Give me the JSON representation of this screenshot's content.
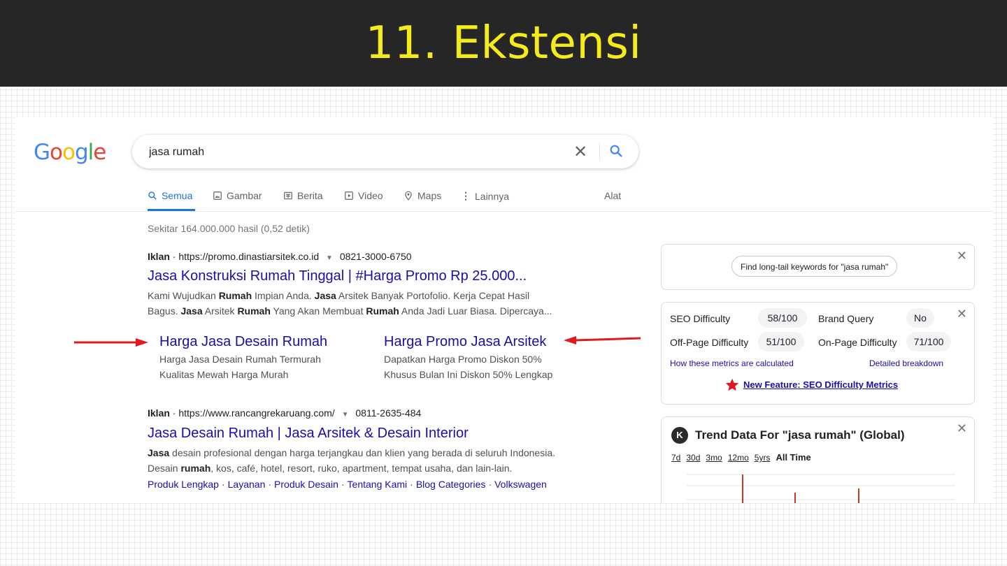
{
  "slide": {
    "title": "11. Ekstensi"
  },
  "google": {
    "logo": [
      {
        "ch": "G",
        "color": "#4285F4"
      },
      {
        "ch": "o",
        "color": "#EA4335"
      },
      {
        "ch": "o",
        "color": "#FBBC05"
      },
      {
        "ch": "g",
        "color": "#4285F4"
      },
      {
        "ch": "l",
        "color": "#34A853"
      },
      {
        "ch": "e",
        "color": "#EA4335"
      }
    ],
    "search": {
      "query": "jasa rumah",
      "clear_icon": "close-icon",
      "search_icon": "magnifier-icon"
    },
    "tabs": {
      "semua": {
        "label": "Semua",
        "icon": "search-icon"
      },
      "gambar": {
        "label": "Gambar",
        "icon": "image-icon"
      },
      "berita": {
        "label": "Berita",
        "icon": "news-icon"
      },
      "video": {
        "label": "Video",
        "icon": "play-icon"
      },
      "maps": {
        "label": "Maps",
        "icon": "pin-icon"
      },
      "lainnya": {
        "label": "Lainnya",
        "icon": "more-vert-icon"
      },
      "alat": {
        "label": "Alat"
      }
    },
    "stats": "Sekitar 164.000.000 hasil (0,52 detik)",
    "ad1": {
      "badge": "Iklan",
      "url": "https://promo.dinastiarsitek.co.id",
      "phone": "0821-3000-6750",
      "title": "Jasa Konstruksi Rumah Tinggal | #Harga Promo Rp 25.000...",
      "desc": [
        [
          {
            "t": "Kami Wujudkan "
          },
          {
            "t": "Rumah",
            "b": true
          },
          {
            "t": " Impian Anda. "
          },
          {
            "t": "Jasa",
            "b": true
          },
          {
            "t": " Arsitek Banyak Portofolio. Kerja Cepat Hasil"
          }
        ],
        [
          {
            "t": "Bagus. "
          },
          {
            "t": "Jasa",
            "b": true
          },
          {
            "t": " Arsitek "
          },
          {
            "t": "Rumah",
            "b": true
          },
          {
            "t": " Yang Akan Membuat "
          },
          {
            "t": "Rumah",
            "b": true
          },
          {
            "t": " Anda Jadi Luar Biasa. Dipercaya..."
          }
        ]
      ],
      "sitelinks": [
        {
          "title": "Harga Jasa Desain Rumah",
          "line1": "Harga Jasa Desain Rumah Termurah",
          "line2": "Kualitas Mewah Harga Murah"
        },
        {
          "title": "Harga Promo Jasa Arsitek",
          "line1": "Dapatkan Harga Promo Diskon 50%",
          "line2": "Khusus Bulan Ini Diskon 50% Lengkap"
        }
      ]
    },
    "ad2": {
      "badge": "Iklan",
      "url": "https://www.rancangrekaruang.com/",
      "phone": "0811-2635-484",
      "title": "Jasa Desain Rumah | Jasa Arsitek & Desain Interior",
      "desc": [
        [
          {
            "t": "Jasa",
            "b": true
          },
          {
            "t": " desain profesional dengan harga terjangkau dan klien yang berada di seluruh Indonesia."
          }
        ],
        [
          {
            "t": "Desain "
          },
          {
            "t": "rumah",
            "b": true
          },
          {
            "t": ", kos, café, hotel, resort, ruko, apartment, tempat usaha, dan lain-lain."
          }
        ]
      ],
      "links": [
        "Produk Lengkap",
        "Layanan",
        "Produk Desain",
        "Tentang Kami",
        "Blog Categories",
        "Volkswagen"
      ]
    }
  },
  "extension": {
    "longtail_button": "Find long-tail keywords for \"jasa rumah\"",
    "seo": {
      "seo_difficulty_label": "SEO Difficulty",
      "seo_difficulty_value": "58/100",
      "brand_query_label": "Brand Query",
      "brand_query_value": "No",
      "offpage_label": "Off-Page Difficulty",
      "offpage_value": "51/100",
      "onpage_label": "On-Page Difficulty",
      "onpage_value": "71/100",
      "how_link": "How these metrics are calculated",
      "breakdown_link": "Detailed breakdown",
      "feature_link": "New Feature: SEO Difficulty Metrics"
    },
    "trend": {
      "logo_letter": "K",
      "title": "Trend Data For \"jasa rumah\" (Global)",
      "ranges": [
        "7d",
        "30d",
        "3mo",
        "12mo",
        "5yrs",
        "All Time"
      ],
      "selected_range": "All Time"
    }
  },
  "colors": {
    "link": "#1a0dab",
    "accent": "#1a73e8",
    "title_bg": "#262626",
    "title_text": "#f5eb1a",
    "arrow": "#e0191e"
  }
}
